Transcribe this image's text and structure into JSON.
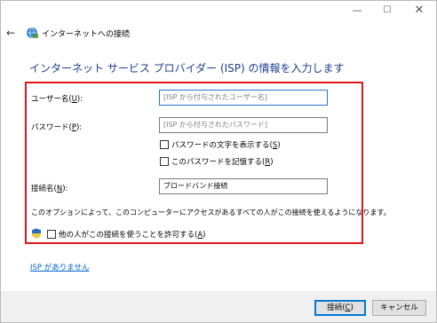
{
  "window": {
    "controls": {
      "minimize": "—",
      "maximize": "☐",
      "close": "✕"
    }
  },
  "nav": {
    "back_icon": "←",
    "title": "インターネットへの接続"
  },
  "heading": "インターネット サービス プロバイダー (ISP) の情報を入力します",
  "form": {
    "username": {
      "label": "ユーザー名(",
      "key": "U",
      "label_end": "):",
      "placeholder": "[ISP から付与されたユーザー名]"
    },
    "password": {
      "label": "パスワード(",
      "key": "P",
      "label_end": "):",
      "placeholder": "[ISP から付与されたパスワード]"
    },
    "show_chars": {
      "label": "パスワードの文字を表示する(",
      "key": "S",
      "label_end": ")",
      "checked": false
    },
    "remember": {
      "label": "このパスワードを記憶する(",
      "key": "R",
      "label_end": ")",
      "checked": false
    },
    "connection_name": {
      "label": "接続名(",
      "key": "N",
      "label_end": "):",
      "value": "ブロードバンド接続"
    },
    "note": "このオプションによって、このコンピューターにアクセスがあるすべての人がこの接続を使えるようになります。",
    "allow_others": {
      "label": "他の人がこの接続を使うことを許可する(",
      "key": "A",
      "label_end": ")",
      "checked": false
    }
  },
  "link": "ISP がありません",
  "buttons": {
    "connect": {
      "label": "接続(",
      "key": "C",
      "label_end": ")"
    },
    "cancel": "キャンセル"
  },
  "colors": {
    "heading": "#1e3f8e",
    "highlight": "#e0141c",
    "link": "#0066cc",
    "focus": "#2a76c6"
  }
}
